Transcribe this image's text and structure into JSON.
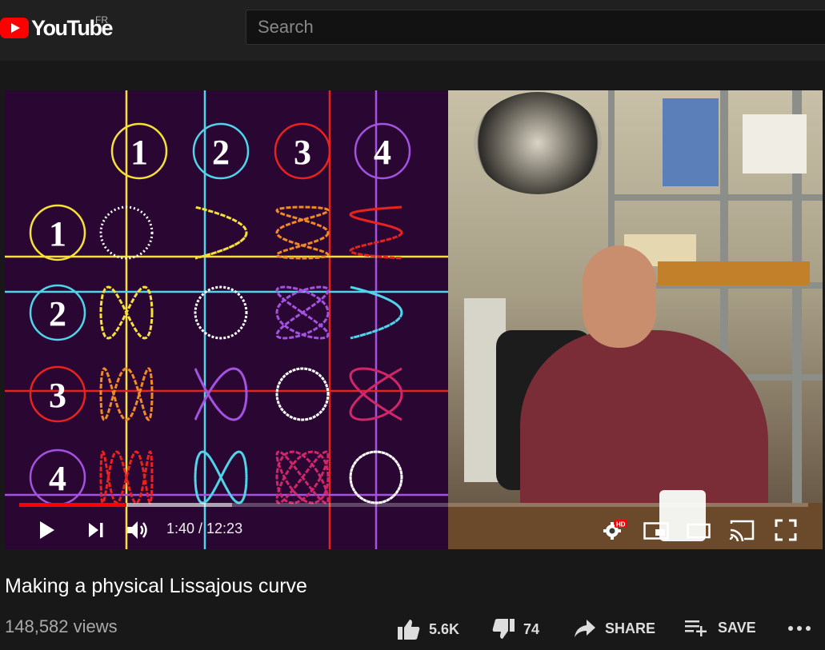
{
  "header": {
    "logo_text": "YouTube",
    "country_code": "FR",
    "search_placeholder": "Search"
  },
  "player": {
    "time_display": "1:40 / 12:23",
    "progress_fraction": 0.136,
    "buffer_fraction": 0.27,
    "hd_badge": "HD",
    "grid_labels": {
      "top": [
        "1",
        "2",
        "3",
        "4"
      ],
      "left": [
        "1",
        "2",
        "3",
        "4"
      ]
    },
    "colors": {
      "yellow": "#f5e13a",
      "cyan": "#4fd4ea",
      "red": "#e8231f",
      "purple": "#a452e0",
      "orange": "#f08a28",
      "white": "#ffffff",
      "background": "#2a0733",
      "progress": "#ff0000"
    }
  },
  "video": {
    "title": "Making a physical Lissajous curve",
    "views": "148,582 views",
    "likes": "5.6K",
    "dislikes": "74",
    "share_label": "SHARE",
    "save_label": "SAVE"
  }
}
